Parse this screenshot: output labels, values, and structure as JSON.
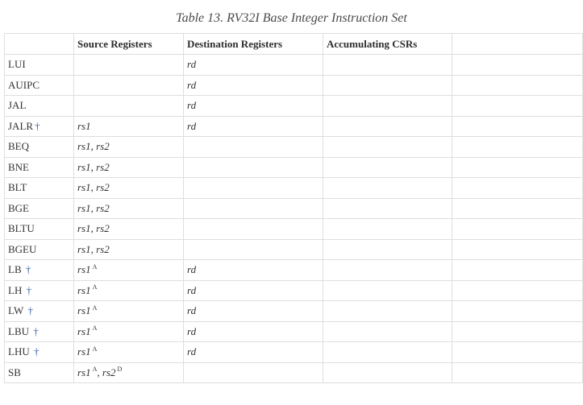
{
  "caption": "Table 13. RV32I Base Integer Instruction Set",
  "headers": [
    "",
    "Source Registers",
    "Destination Registers",
    "Accumulating CSRs",
    ""
  ],
  "rows": [
    {
      "instr": "LUI",
      "dagger": "",
      "src": "",
      "src_sup": "",
      "src2": "",
      "src2_sup": "",
      "dst": "rd"
    },
    {
      "instr": "AUIPC",
      "dagger": "",
      "src": "",
      "src_sup": "",
      "src2": "",
      "src2_sup": "",
      "dst": "rd"
    },
    {
      "instr": "JAL",
      "dagger": "",
      "src": "",
      "src_sup": "",
      "src2": "",
      "src2_sup": "",
      "dst": "rd"
    },
    {
      "instr": "JALR",
      "dagger": "†",
      "src": "rs1",
      "src_sup": "",
      "src2": "",
      "src2_sup": "",
      "dst": "rd"
    },
    {
      "instr": "BEQ",
      "dagger": "",
      "src": "rs1, rs2",
      "src_sup": "",
      "src2": "",
      "src2_sup": "",
      "dst": ""
    },
    {
      "instr": "BNE",
      "dagger": "",
      "src": "rs1, rs2",
      "src_sup": "",
      "src2": "",
      "src2_sup": "",
      "dst": ""
    },
    {
      "instr": "BLT",
      "dagger": "",
      "src": "rs1, rs2",
      "src_sup": "",
      "src2": "",
      "src2_sup": "",
      "dst": ""
    },
    {
      "instr": "BGE",
      "dagger": "",
      "src": "rs1, rs2",
      "src_sup": "",
      "src2": "",
      "src2_sup": "",
      "dst": ""
    },
    {
      "instr": "BLTU",
      "dagger": "",
      "src": "rs1, rs2",
      "src_sup": "",
      "src2": "",
      "src2_sup": "",
      "dst": ""
    },
    {
      "instr": "BGEU",
      "dagger": "",
      "src": "rs1, rs2",
      "src_sup": "",
      "src2": "",
      "src2_sup": "",
      "dst": ""
    },
    {
      "instr": "LB",
      "dagger": " †",
      "src": "rs1",
      "src_sup": "A",
      "src2": "",
      "src2_sup": "",
      "dst": "rd"
    },
    {
      "instr": "LH",
      "dagger": " †",
      "src": "rs1",
      "src_sup": "A",
      "src2": "",
      "src2_sup": "",
      "dst": "rd"
    },
    {
      "instr": "LW",
      "dagger": " †",
      "src": "rs1",
      "src_sup": "A",
      "src2": "",
      "src2_sup": "",
      "dst": "rd"
    },
    {
      "instr": "LBU",
      "dagger": " †",
      "src": "rs1",
      "src_sup": "A",
      "src2": "",
      "src2_sup": "",
      "dst": "rd"
    },
    {
      "instr": "LHU",
      "dagger": " †",
      "src": "rs1",
      "src_sup": "A",
      "src2": "",
      "src2_sup": "",
      "dst": "rd"
    },
    {
      "instr": "SB",
      "dagger": "",
      "src": "rs1",
      "src_sup": "A",
      "src2": ", rs2",
      "src2_sup": "D",
      "dst": ""
    }
  ]
}
